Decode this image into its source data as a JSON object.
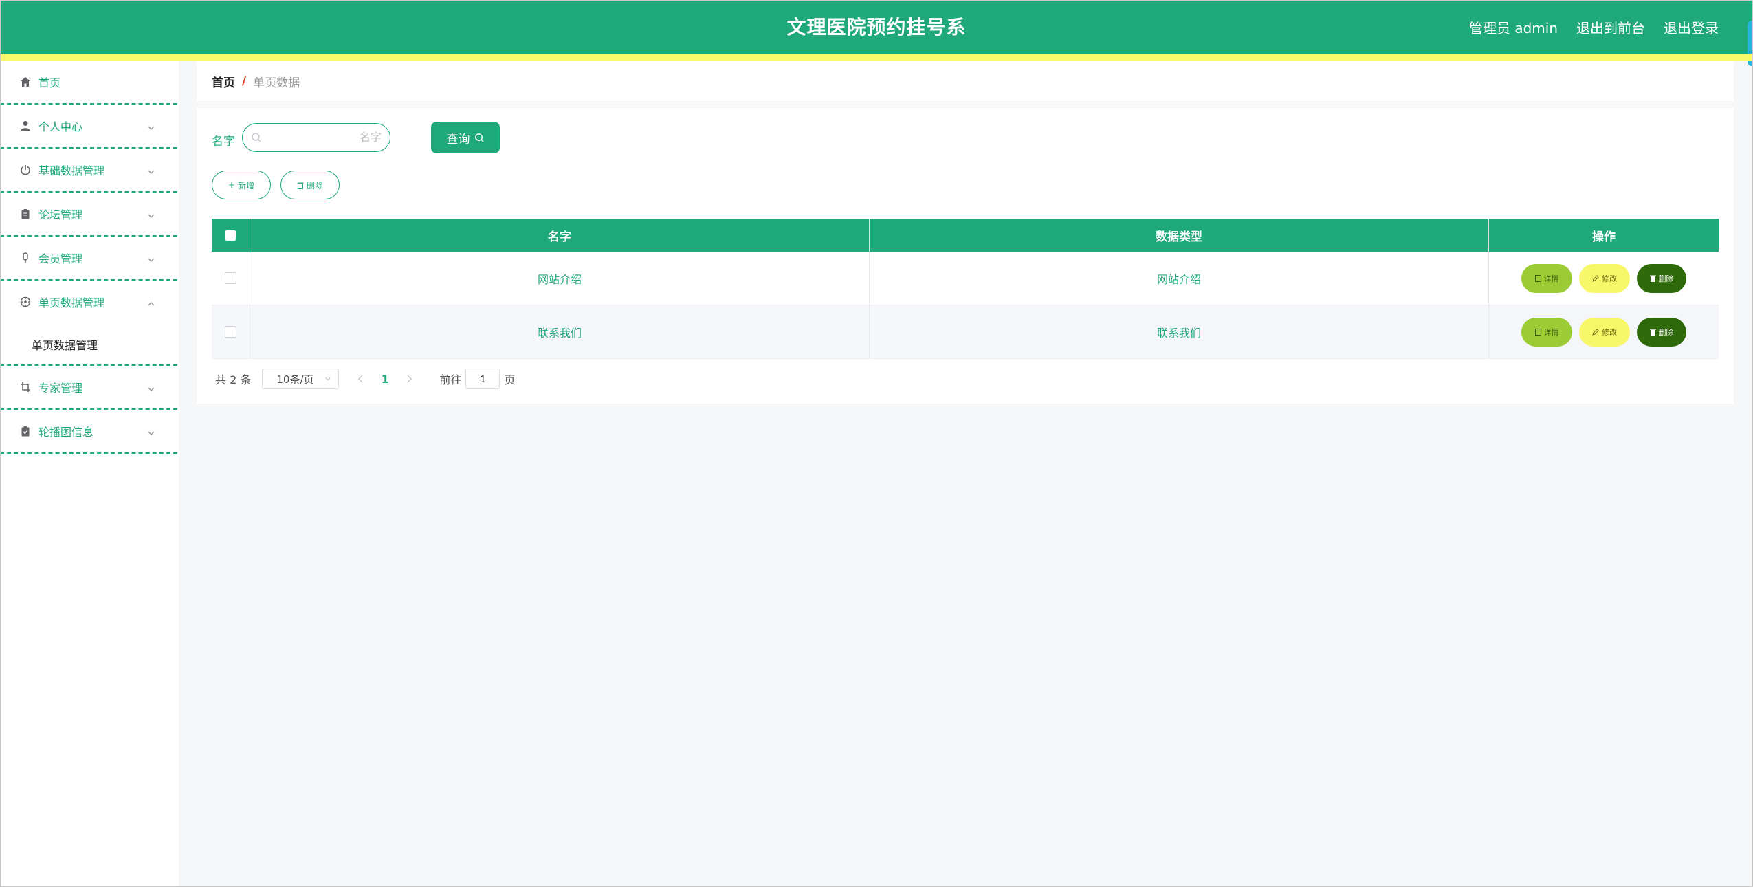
{
  "header": {
    "title": "文理医院预约挂号系",
    "user_label": "管理员 admin",
    "to_front": "退出到前台",
    "logout": "退出登录"
  },
  "sidebar": {
    "items": [
      {
        "label": "首页",
        "icon": "home-icon"
      },
      {
        "label": "个人中心",
        "icon": "user-icon"
      },
      {
        "label": "基础数据管理",
        "icon": "power-icon"
      },
      {
        "label": "论坛管理",
        "icon": "clipboard-icon"
      },
      {
        "label": "会员管理",
        "icon": "mic-icon"
      },
      {
        "label": "单页数据管理",
        "icon": "compass-icon",
        "expanded": true,
        "children": [
          {
            "label": "单页数据管理"
          }
        ]
      },
      {
        "label": "专家管理",
        "icon": "crop-icon"
      },
      {
        "label": "轮播图信息",
        "icon": "clipboard-check-icon"
      }
    ]
  },
  "breadcrumb": {
    "home": "首页",
    "separator": "/",
    "current": "单页数据"
  },
  "search": {
    "label": "名字",
    "placeholder": "名字",
    "query_button": "查询"
  },
  "actions": {
    "add": "新增",
    "delete": "删除"
  },
  "table": {
    "columns": [
      "名字",
      "数据类型",
      "操作"
    ],
    "rows": [
      {
        "name": "网站介绍",
        "type": "网站介绍"
      },
      {
        "name": "联系我们",
        "type": "联系我们"
      }
    ],
    "row_actions": {
      "detail": "详情",
      "edit": "修改",
      "delete": "删除"
    }
  },
  "pagination": {
    "total": "共 2 条",
    "page_size": "10条/页",
    "current_page": "1",
    "goto_label": "前往",
    "goto_value": "1",
    "page_suffix": "页"
  },
  "colors": {
    "primary": "#1fa87a",
    "accent_strip": "#f7f96a",
    "detail_button": "#9ccc35",
    "edit_button": "#f8f76a",
    "delete_button": "#2f6a0a"
  }
}
